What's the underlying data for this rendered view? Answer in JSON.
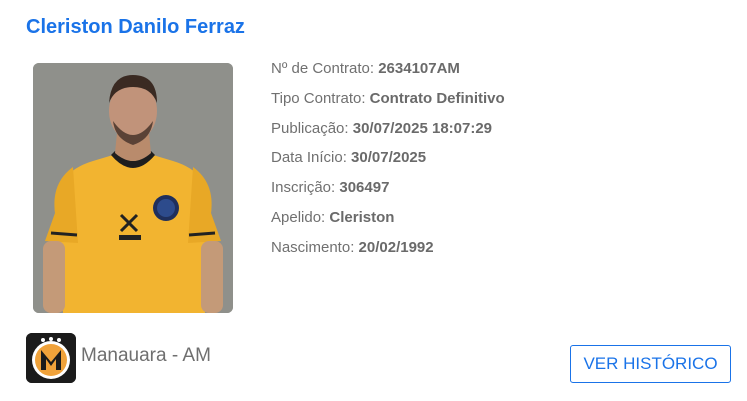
{
  "player": {
    "name": "Cleriston Danilo Ferraz"
  },
  "details": [
    {
      "label": "Nº de Contrato:",
      "value": "2634107AM"
    },
    {
      "label": "Tipo Contrato:",
      "value": "Contrato Definitivo"
    },
    {
      "label": "Publicação:",
      "value": "30/07/2025 18:07:29"
    },
    {
      "label": "Data Início:",
      "value": "30/07/2025"
    },
    {
      "label": "Inscrição:",
      "value": "306497"
    },
    {
      "label": "Apelido:",
      "value": "Cleriston"
    },
    {
      "label": "Nascimento:",
      "value": "20/02/1992"
    }
  ],
  "club": {
    "name": "Manauara - AM",
    "logo_letter": "M"
  },
  "actions": {
    "history_label": "VER HISTÓRICO"
  },
  "colors": {
    "accent": "#1a73e8",
    "jersey": "#f2b430",
    "photo_background": "#8f908b"
  }
}
